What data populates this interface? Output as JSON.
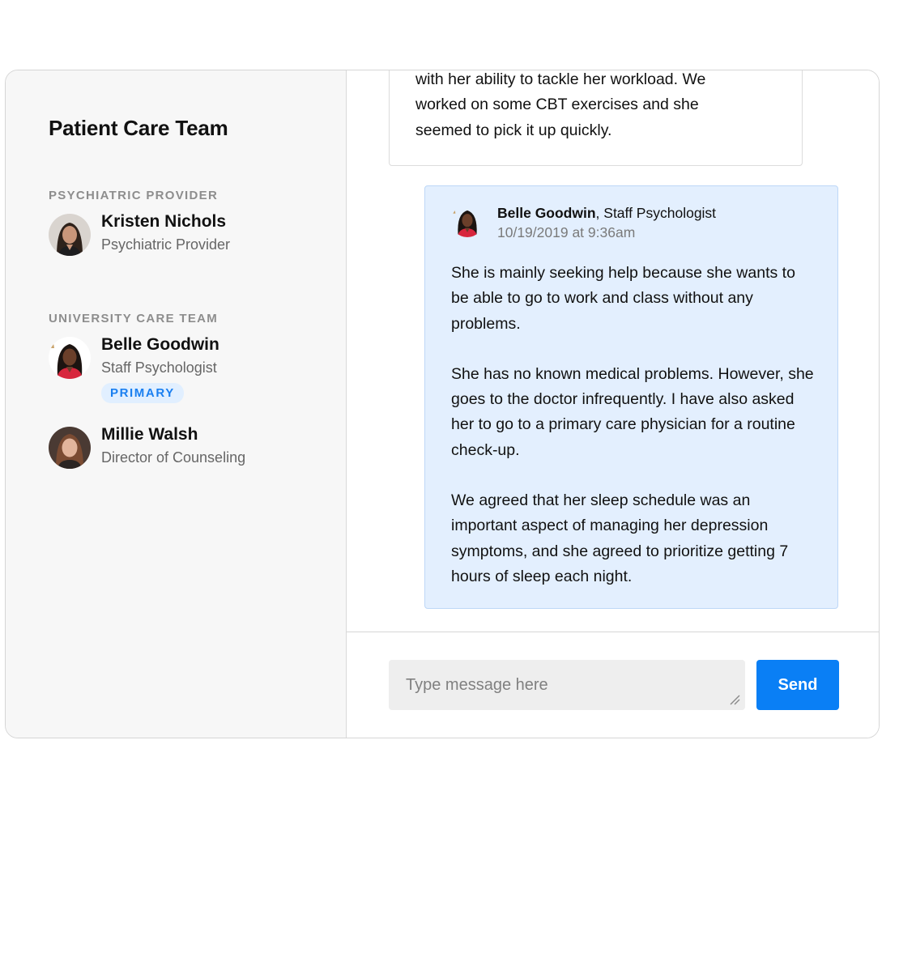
{
  "sidebar": {
    "title": "Patient Care Team",
    "sections": [
      {
        "label": "PSYCHIATRIC PROVIDER",
        "members": [
          {
            "name": "Kristen Nichols",
            "role": "Psychiatric Provider",
            "avatar": "avatar-photo"
          }
        ]
      },
      {
        "label": "UNIVERSITY CARE TEAM",
        "members": [
          {
            "name": "Belle Goodwin",
            "role": "Staff Psychologist",
            "badge": "PRIMARY",
            "avatar": "avatar-photo"
          },
          {
            "name": "Millie Walsh",
            "role": "Director of Counseling",
            "avatar": "avatar-photo"
          }
        ]
      }
    ]
  },
  "conversation": {
    "previous_message": {
      "text": "with her ability to tackle her workload. We\nworked on some CBT exercises and she\nseemed to pick it up quickly."
    },
    "message": {
      "author": "Belle Goodwin",
      "author_title": ", Staff Psychologist",
      "timestamp": "10/19/2019 at 9:36am",
      "paragraphs": [
        "She is mainly seeking help because she wants to be able to go to work and class without any problems.",
        "She has no known medical problems. However, she goes to the doctor infrequently. I have also asked her to go to a primary care physician for a routine check-up.",
        "We agreed that her sleep schedule was an important aspect of managing her depression symptoms, and she agreed to prioritize getting 7 hours of sleep each night."
      ]
    }
  },
  "composer": {
    "placeholder": "Type message here",
    "value": "",
    "send_label": "Send"
  },
  "colors": {
    "accent": "#0a7ff5",
    "badge_bg": "#e1efff",
    "message_bg": "#e3effe",
    "sidebar_bg": "#f7f7f7"
  }
}
